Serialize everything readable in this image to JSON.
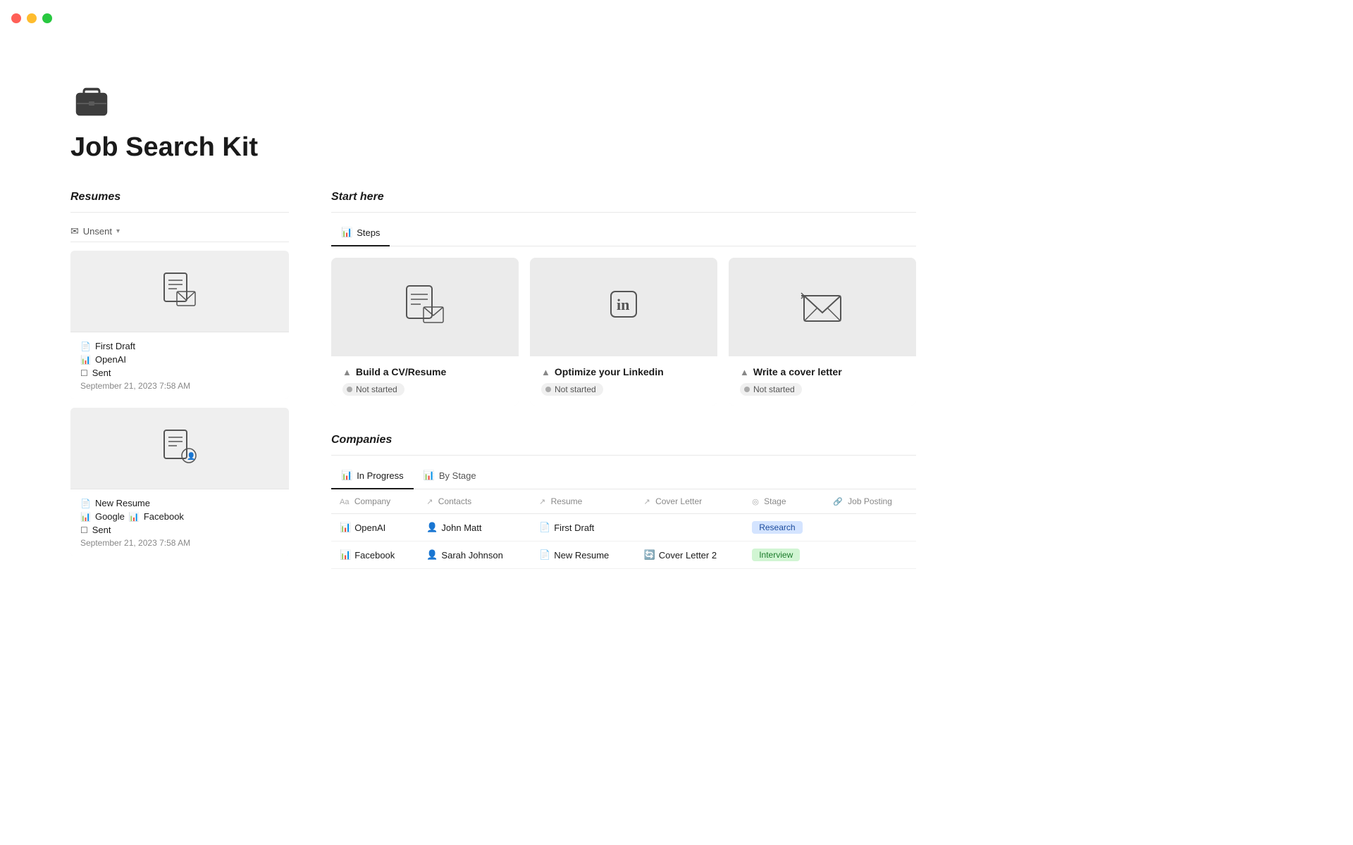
{
  "titlebar": {
    "traffic_lights": [
      "red",
      "yellow",
      "green"
    ]
  },
  "page": {
    "title": "Job Search Kit"
  },
  "resumes": {
    "section_heading": "Resumes",
    "filter": {
      "icon": "✉",
      "label": "Unsent",
      "chevron": "▾"
    },
    "cards": [
      {
        "name": "First Draft",
        "tags": [
          "OpenAI"
        ],
        "sent_label": "Sent",
        "date": "September 21, 2023 7:58 AM"
      },
      {
        "name": "New Resume",
        "tags": [
          "Google",
          "Facebook"
        ],
        "sent_label": "Sent",
        "date": "September 21, 2023 7:58 AM"
      }
    ]
  },
  "start_here": {
    "section_heading": "Start here",
    "tabs": [
      {
        "label": "Steps",
        "icon": "📊",
        "active": true
      }
    ],
    "steps": [
      {
        "title": "Build a CV/Resume",
        "status": "Not started",
        "warn_icon": "▲"
      },
      {
        "title": "Optimize your Linkedin",
        "status": "Not started",
        "warn_icon": "▲"
      },
      {
        "title": "Write a cover letter",
        "status": "Not started",
        "warn_icon": "▲"
      }
    ]
  },
  "companies": {
    "section_heading": "Companies",
    "tabs": [
      {
        "label": "In Progress",
        "icon": "📊",
        "active": true
      },
      {
        "label": "By Stage",
        "icon": "📊",
        "active": false
      }
    ],
    "columns": [
      {
        "label": "Company",
        "icon": "Aa"
      },
      {
        "label": "Contacts",
        "icon": "↗"
      },
      {
        "label": "Resume",
        "icon": "↗"
      },
      {
        "label": "Cover Letter",
        "icon": "↗"
      },
      {
        "label": "Stage",
        "icon": "◎"
      },
      {
        "label": "Job Posting",
        "icon": "🔗"
      }
    ],
    "rows": [
      {
        "company": "OpenAI",
        "contact": "John Matt",
        "resume": "First Draft",
        "cover_letter": "",
        "stage": "Research",
        "stage_type": "research",
        "job_posting": ""
      },
      {
        "company": "Facebook",
        "contact": "Sarah Johnson",
        "resume": "New Resume",
        "cover_letter": "Cover Letter 2",
        "stage": "Interview",
        "stage_type": "interview",
        "job_posting": ""
      }
    ]
  }
}
